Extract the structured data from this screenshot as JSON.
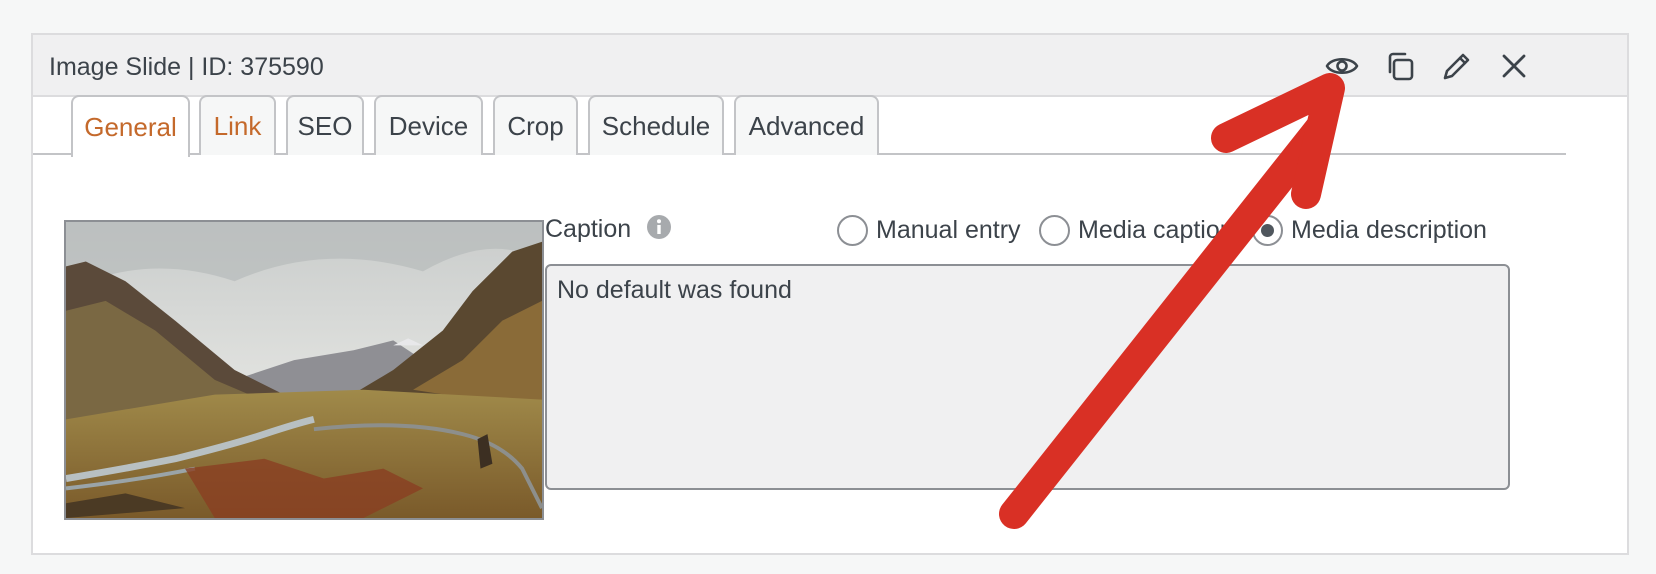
{
  "panel": {
    "title": "Image Slide | ID: 375590",
    "icons": [
      "eye-icon",
      "duplicate-icon",
      "edit-icon",
      "close-icon"
    ]
  },
  "tabs": [
    {
      "label": "General",
      "active": true
    },
    {
      "label": "Link",
      "active": false
    },
    {
      "label": "SEO",
      "active": false
    },
    {
      "label": "Device",
      "active": false
    },
    {
      "label": "Crop",
      "active": false
    },
    {
      "label": "Schedule",
      "active": false
    },
    {
      "label": "Advanced",
      "active": false
    }
  ],
  "caption": {
    "label": "Caption",
    "info_icon": "info-icon",
    "options": [
      {
        "label": "Manual entry",
        "selected": false
      },
      {
        "label": "Media caption",
        "selected": false
      },
      {
        "label": "Media description",
        "selected": true
      }
    ],
    "value": "No default was found"
  },
  "image": {
    "subject": "mountain valley landscape"
  },
  "colors": {
    "accent": "#c4692b",
    "arrow": "#d93025",
    "header_bg": "#f0f0f1",
    "border": "#c3c4c7"
  }
}
